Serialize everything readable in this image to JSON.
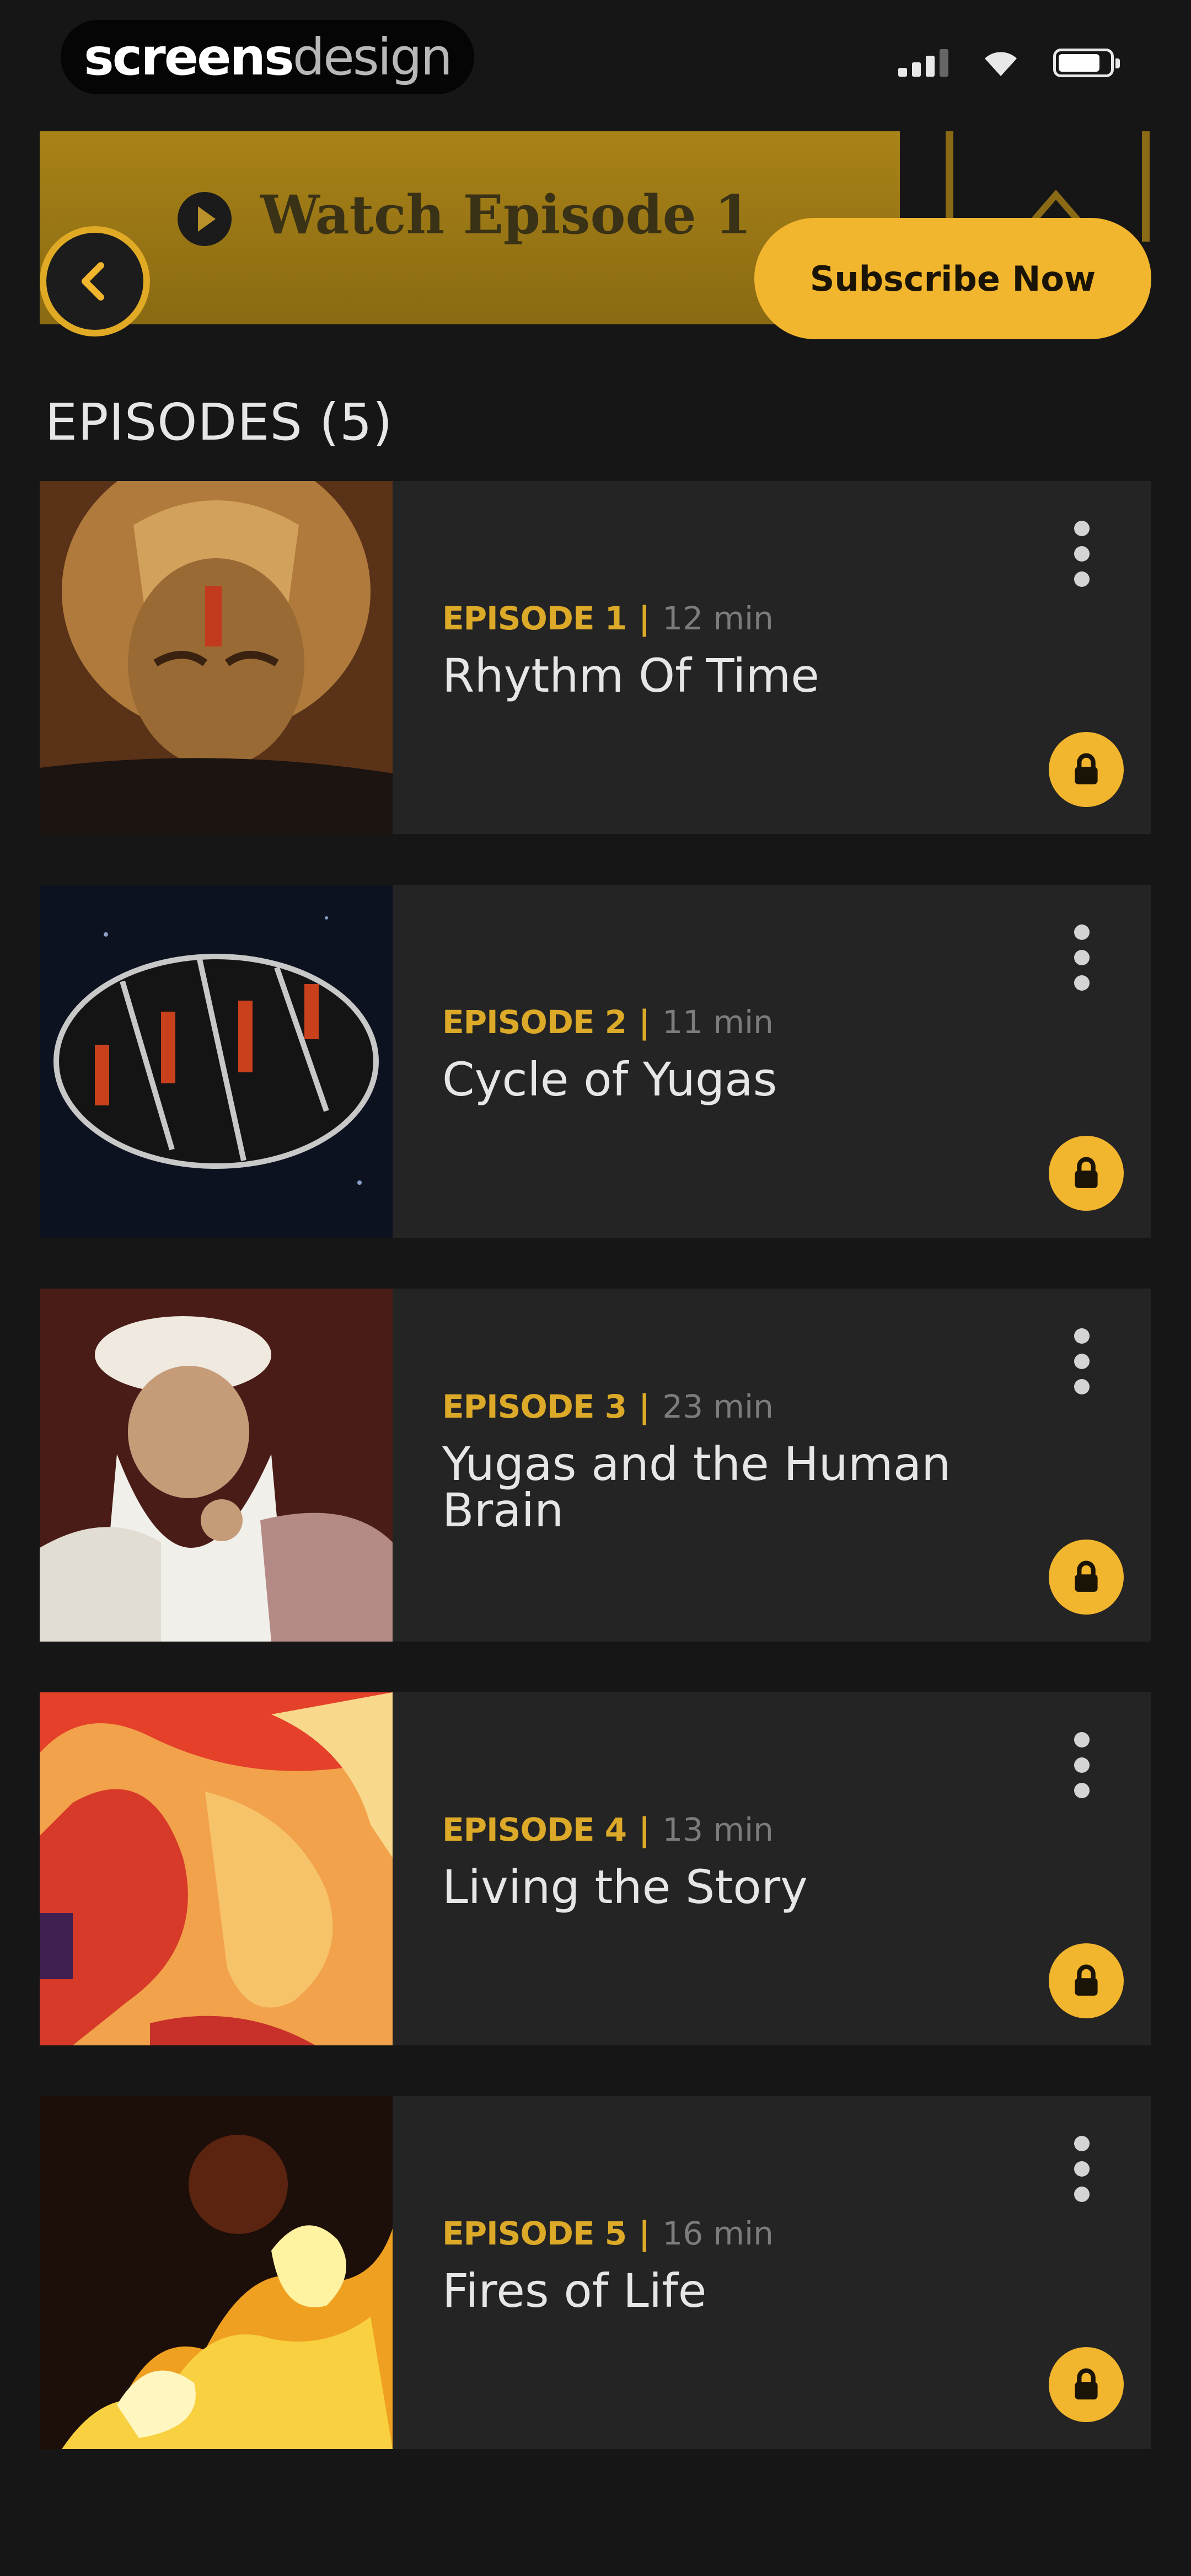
{
  "status_bar": {
    "brand_part1": "screens",
    "brand_part2": "design",
    "signal_icon": "cellular-signal-icon",
    "wifi_icon": "wifi-icon",
    "battery_icon": "battery-icon"
  },
  "banner": {
    "watch_label": "Watch Episode 1",
    "play_icon": "play-icon",
    "home_icon": "home-icon"
  },
  "back_icon": "chevron-left-icon",
  "subscribe_label": "Subscribe Now",
  "episodes_heading": "EPISODES (5)",
  "episodes": [
    {
      "number": "EPISODE 1",
      "separator": "|",
      "duration": "12 min",
      "title": "Rhythm Of Time"
    },
    {
      "number": "EPISODE 2",
      "separator": "|",
      "duration": "11 min",
      "title": "Cycle of Yugas"
    },
    {
      "number": "EPISODE 3",
      "separator": "|",
      "duration": "23 min",
      "title": "Yugas and the Human Brain"
    },
    {
      "number": "EPISODE 4",
      "separator": "|",
      "duration": "13 min",
      "title": "Living the Story"
    },
    {
      "number": "EPISODE 5",
      "separator": "|",
      "duration": "16 min",
      "title": "Fires of Life"
    }
  ],
  "icons": {
    "more": "more-vertical-icon",
    "lock": "lock-icon"
  },
  "colors": {
    "accent": "#f2b52e",
    "background": "#161616",
    "card": "#242424",
    "banner": "#a98318"
  }
}
